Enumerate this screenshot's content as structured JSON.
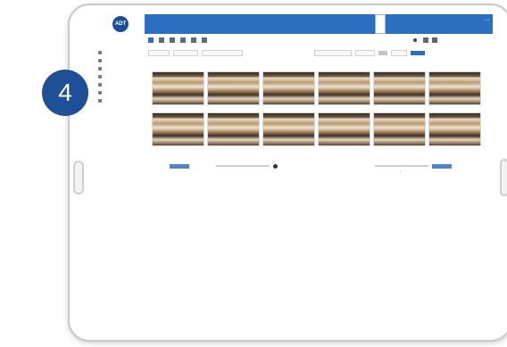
{
  "step": {
    "number": "4"
  },
  "app": {
    "logo_text": "ADT",
    "brand_subtitle": ""
  },
  "sidebar": {
    "items": [
      {
        "label": ""
      },
      {
        "label": ""
      },
      {
        "label": ""
      },
      {
        "label": ""
      },
      {
        "label": ""
      },
      {
        "label": ""
      },
      {
        "label": ""
      }
    ]
  },
  "topbar": {
    "tabs": [
      {
        "label": ""
      },
      {
        "label": ""
      },
      {
        "label": ""
      },
      {
        "label": ""
      }
    ],
    "active_tab_index": 1
  },
  "toolbar": {
    "user_label": ""
  },
  "thumbnails": {
    "count": 12
  },
  "colors": {
    "accent": "#2a6fc0",
    "step_badge": "#1f4f96",
    "logo": "#1b4f95"
  },
  "icons": [
    "adt-logo-icon",
    "sidebar-icons",
    "toolbar-icons",
    "play-icon",
    "grid-icon"
  ]
}
